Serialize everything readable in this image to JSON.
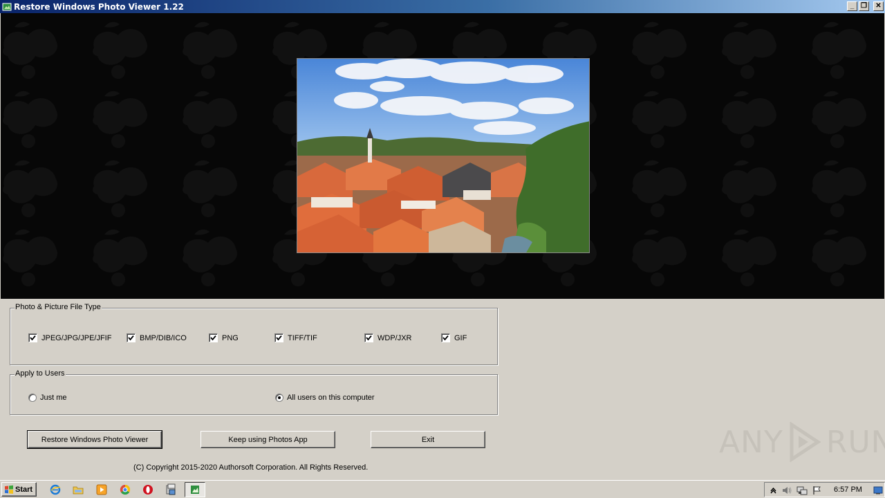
{
  "window": {
    "title": "Restore Windows Photo Viewer 1.22",
    "controls": {
      "minimize": "_",
      "restore": "❐",
      "close": "✕"
    }
  },
  "file_types": {
    "legend": "Photo & Picture File Type",
    "items": [
      {
        "label": "JPEG/JPG/JPE/JFIF",
        "checked": true
      },
      {
        "label": "BMP/DIB/ICO",
        "checked": true
      },
      {
        "label": "PNG",
        "checked": true
      },
      {
        "label": "TIFF/TIF",
        "checked": true
      },
      {
        "label": "WDP/JXR",
        "checked": true
      },
      {
        "label": "GIF",
        "checked": true
      }
    ]
  },
  "users": {
    "legend": "Apply to Users",
    "options": [
      {
        "label": "Just me",
        "selected": false
      },
      {
        "label": "All users on this computer",
        "selected": true
      }
    ]
  },
  "buttons": {
    "restore": "Restore Windows Photo Viewer",
    "keep": "Keep using Photos App",
    "exit": "Exit"
  },
  "copyright": "(C) Copyright 2015-2020 Authorsoft Corporation. All Rights Reserved.",
  "watermark": {
    "left": "ANY",
    "right": "RUN"
  },
  "taskbar": {
    "start_label": "Start",
    "quick_launch": [
      "ie-icon",
      "folder-icon",
      "media-player-icon",
      "chrome-icon",
      "opera-icon",
      "installer-icon"
    ],
    "active_task": "photo-viewer-task-icon",
    "tray": [
      "show-hidden-icons-icon",
      "volume-icon",
      "network-icon",
      "action-center-flag-icon"
    ],
    "clock": "6:57 PM"
  },
  "colors": {
    "title_gradient_start": "#0a246a",
    "title_gradient_end": "#a6caf0",
    "window_face": "#d4d0c8",
    "banner_bg": "#070707"
  }
}
